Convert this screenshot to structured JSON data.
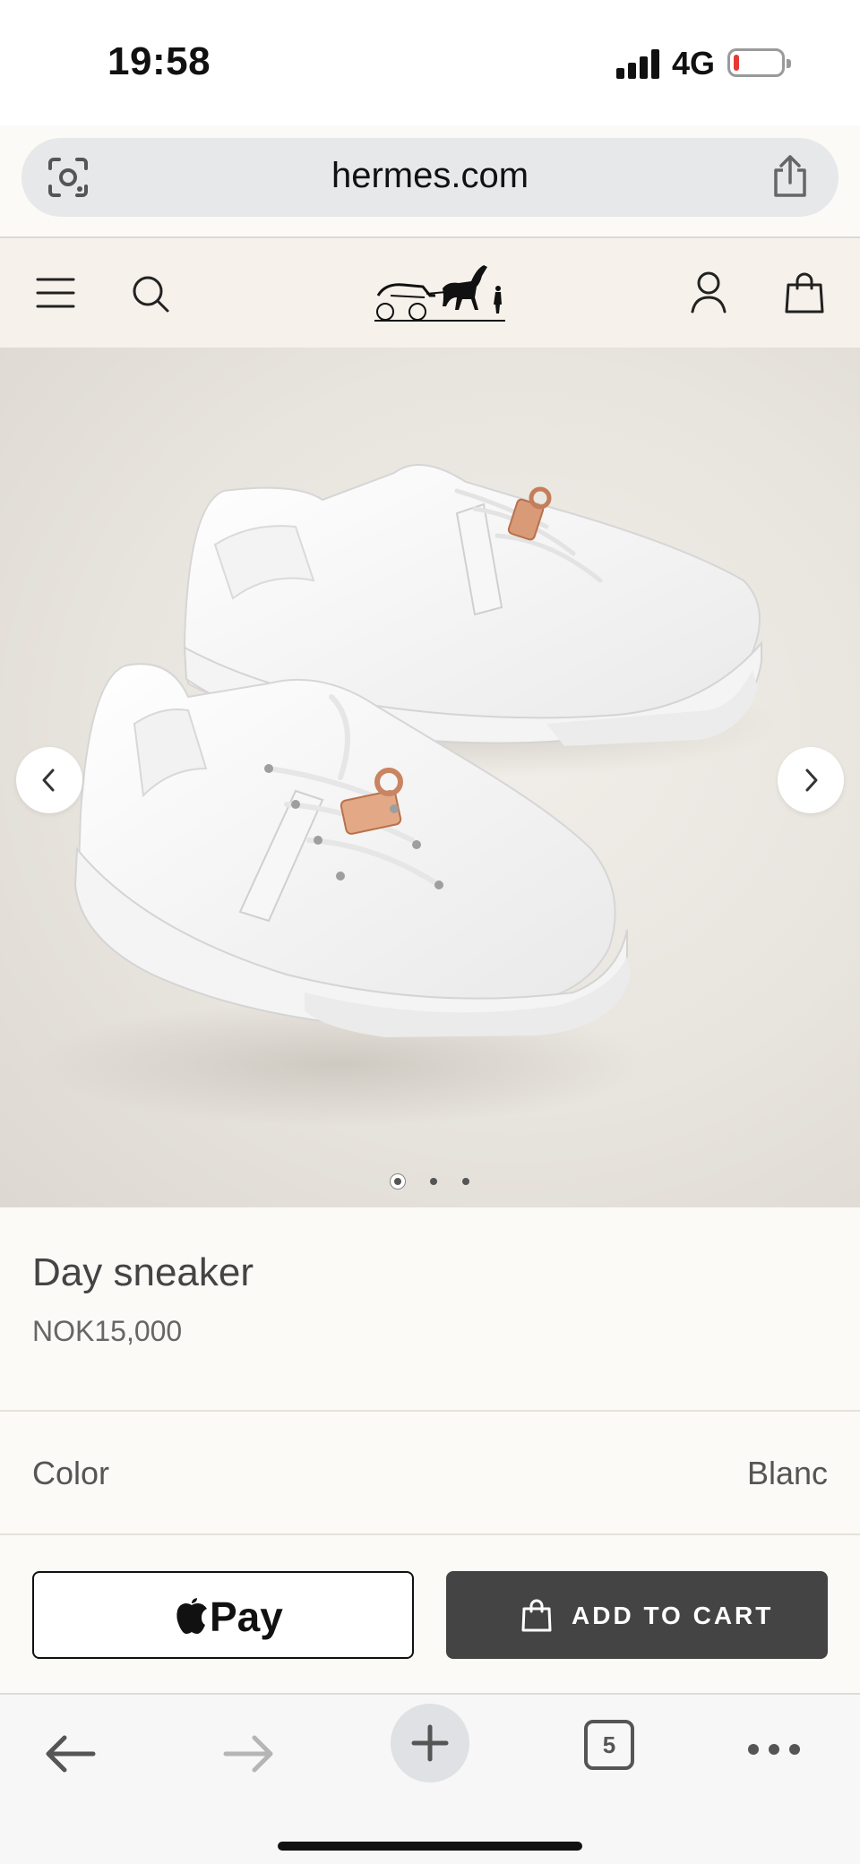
{
  "status_bar": {
    "time": "19:58",
    "network": "4G"
  },
  "browser": {
    "url": "hermes.com",
    "tab_count": "5"
  },
  "site_header": {
    "icons": [
      "menu-icon",
      "search-icon",
      "hermes-logo",
      "account-icon",
      "shopping-bag-icon"
    ]
  },
  "gallery": {
    "image_count": 3,
    "active_index": 0
  },
  "product": {
    "name": "Day sneaker",
    "price": "NOK15,000"
  },
  "color": {
    "label": "Color",
    "value": "Blanc"
  },
  "actions": {
    "apple_pay_label": "Pay",
    "add_to_cart_label": "ADD TO CART"
  },
  "colors": {
    "header_bg": "#f6f1ea",
    "page_bg": "#fcfaf6",
    "button_dark": "#444444",
    "url_bar": "#e6e8ea"
  }
}
